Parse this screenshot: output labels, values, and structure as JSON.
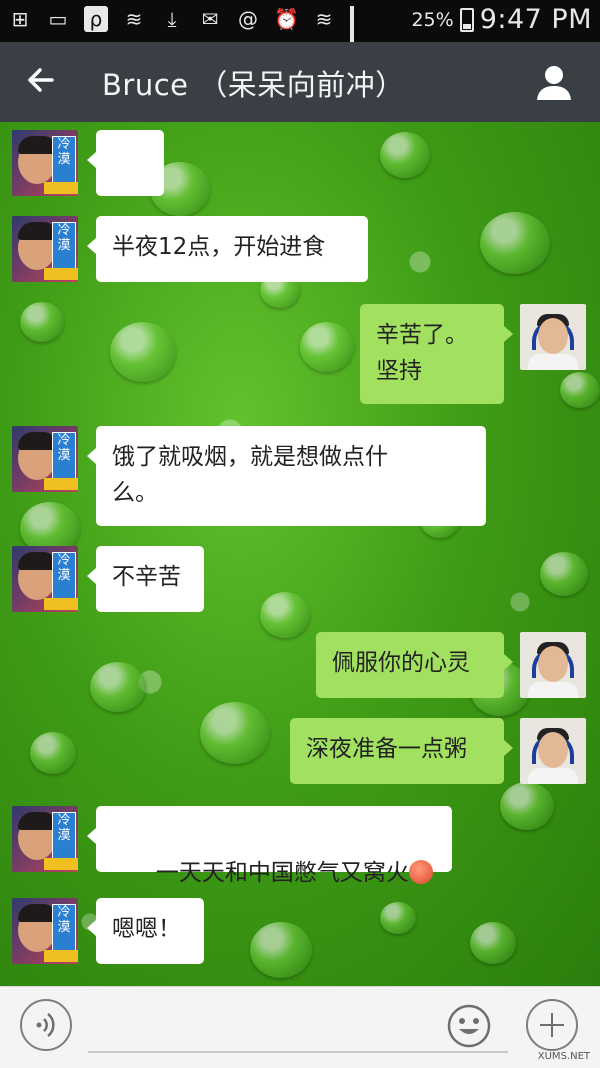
{
  "status_bar": {
    "battery_percent": "25%",
    "time": "9:47 PM",
    "left_icons": [
      "add-box-icon",
      "phone-check-icon",
      "p-app-icon",
      "wifi-icon",
      "download-icon",
      "mail-icon",
      "mail-at-icon",
      "alarm-icon",
      "wifi-signal-icon",
      "cell-signal-icon"
    ]
  },
  "title_bar": {
    "title": "Bruce （呆呆向前冲）"
  },
  "messages": [
    {
      "side": "left",
      "text": "👍"
    },
    {
      "side": "left",
      "text": "半夜12点，开始进食"
    },
    {
      "side": "right",
      "text": "辛苦了。\n坚持"
    },
    {
      "side": "left",
      "text": "饿了就吸烟，就是想做点什\n么。"
    },
    {
      "side": "left",
      "text": "不辛苦"
    },
    {
      "side": "right",
      "text": "佩服你的心灵"
    },
    {
      "side": "right",
      "text": "深夜准备一点粥"
    },
    {
      "side": "left",
      "text": "一天天和中国憋气又窝火"
    },
    {
      "side": "left",
      "text": "嗯嗯！"
    }
  ],
  "bottom_bar": {
    "watermark": "XUMS.NET"
  },
  "colors": {
    "title_bar": "#3a3f45",
    "bubble_left": "#ffffff",
    "bubble_right": "#a2e15f",
    "background": "#3f9c16"
  }
}
